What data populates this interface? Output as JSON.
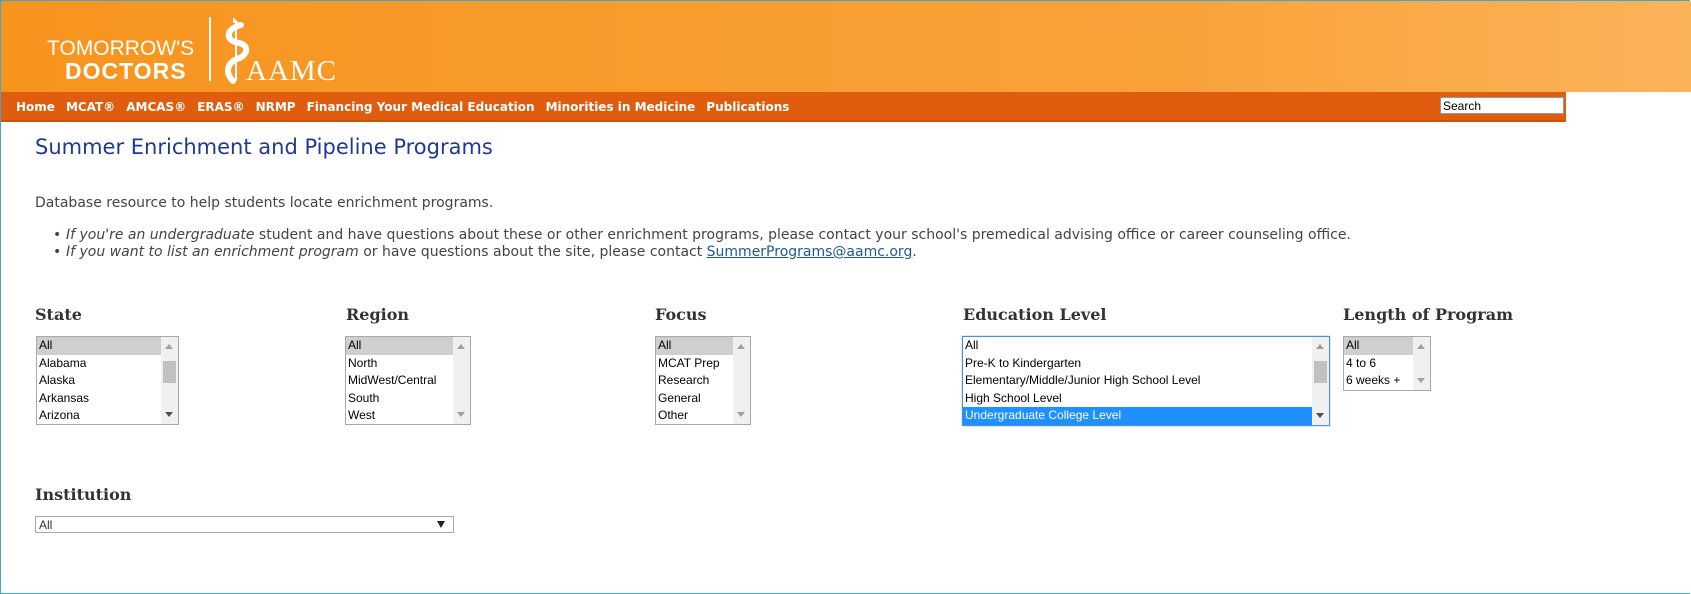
{
  "header": {
    "logo_line1": "TOMORROW'S",
    "logo_line2": "DOCTORS",
    "logo_aamc": "AAMC"
  },
  "nav": {
    "items": [
      "Home",
      "MCAT®",
      "AMCAS®",
      "ERAS®",
      "NRMP",
      "Financing Your Medical Education",
      "Minorities in Medicine",
      "Publications"
    ],
    "search_value": "Search"
  },
  "page": {
    "title": "Summer Enrichment and Pipeline Programs",
    "description": "Database resource to help students locate enrichment programs.",
    "bullet1_italic": "If you're an undergraduate",
    "bullet1_rest": " student and have questions about these or other enrichment programs, please contact your school's premedical advising office or career counseling office.",
    "bullet2_italic": "If you want to list an enrichment program",
    "bullet2_rest": " or have questions about the site, please contact ",
    "bullet2_link": "SummerPrograms@aamc.org",
    "bullet2_end": "."
  },
  "filters": {
    "state": {
      "label": "State",
      "options": [
        "All",
        "Alabama",
        "Alaska",
        "Arkansas",
        "Arizona"
      ],
      "selected": "All"
    },
    "region": {
      "label": "Region",
      "options": [
        "All",
        "North",
        "MidWest/Central",
        "South",
        "West"
      ],
      "selected": "All"
    },
    "focus": {
      "label": "Focus",
      "options": [
        "All",
        "MCAT Prep",
        "Research",
        "General",
        "Other"
      ],
      "selected": "All"
    },
    "education": {
      "label": "Education Level",
      "options": [
        "All",
        "Pre-K to Kindergarten",
        "Elementary/Middle/Junior High School Level",
        "High School Level",
        "Undergraduate College Level"
      ],
      "selected": "Undergraduate College Level"
    },
    "length": {
      "label": "Length of Program",
      "options": [
        "All",
        "4 to 6",
        "6 weeks +"
      ],
      "selected": "All"
    },
    "institution": {
      "label": "Institution",
      "value": "All"
    }
  },
  "colors": {
    "header_orange": "#f7941d",
    "nav_orange": "#e05d0f",
    "title_blue": "#1f3a93",
    "selection_blue": "#1e90ff"
  }
}
